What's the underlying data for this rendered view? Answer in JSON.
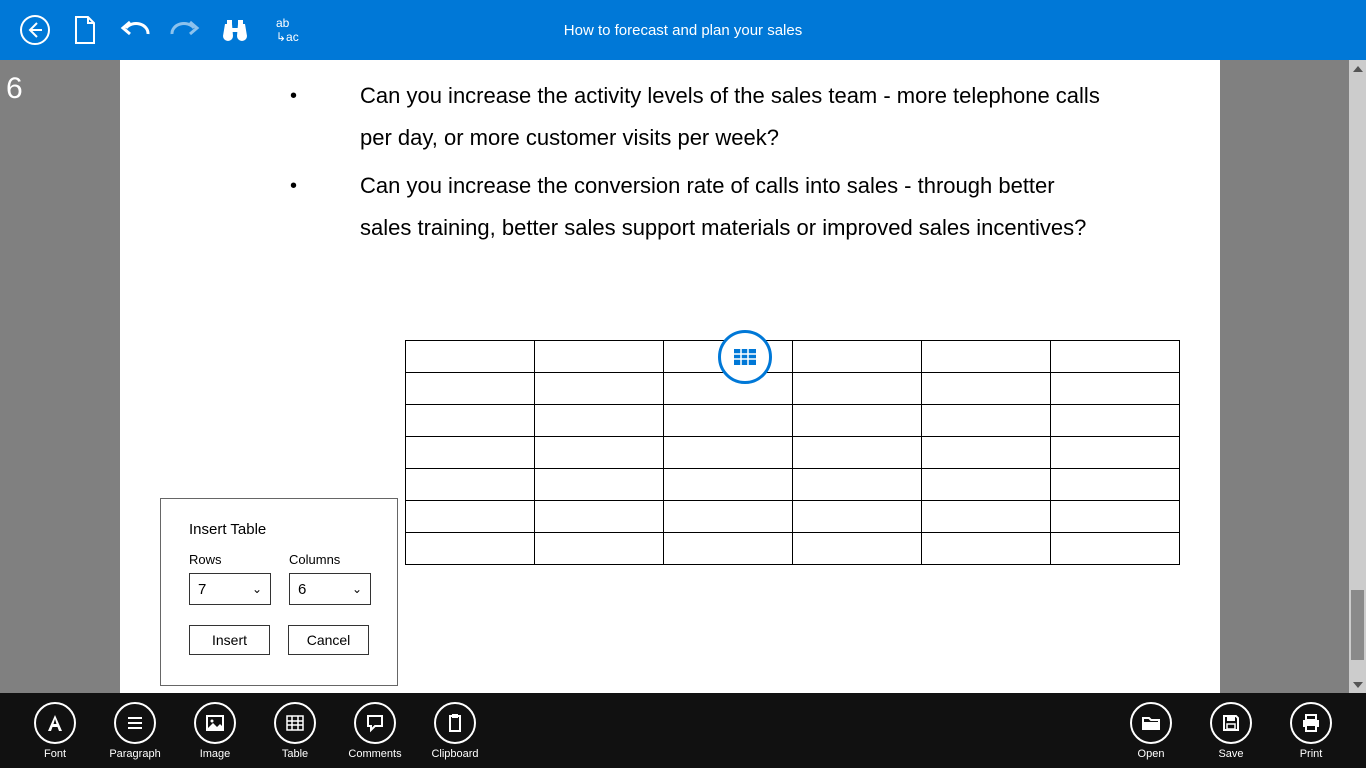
{
  "header": {
    "title": "How to forecast and plan your sales"
  },
  "page": {
    "number": "6",
    "bullets": [
      "Can you increase the activity levels of the sales team - more telephone calls per day, or more customer visits per week?",
      "Can you increase the conversion rate of calls into sales - through better sales training, better sales support materials or improved sales incentives?"
    ]
  },
  "popover": {
    "title": "Insert Table",
    "rows_label": "Rows",
    "cols_label": "Columns",
    "rows_value": "7",
    "cols_value": "6",
    "insert_label": "Insert",
    "cancel_label": "Cancel"
  },
  "appbar": {
    "font": "Font",
    "paragraph": "Paragraph",
    "image": "Image",
    "table": "Table",
    "comments": "Comments",
    "clipboard": "Clipboard",
    "open": "Open",
    "save": "Save",
    "print": "Print"
  },
  "toolbar_findrepl": {
    "line1": "ab",
    "line2": "↳ac"
  }
}
